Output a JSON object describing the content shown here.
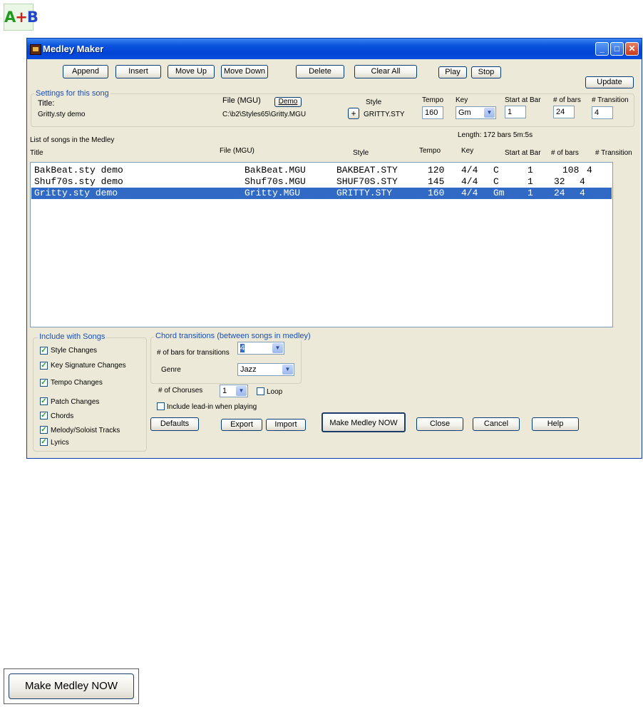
{
  "app_icon": {
    "a": "A",
    "plus": "+",
    "b": "B",
    "name": "a-plus-b-icon"
  },
  "window": {
    "title": "Medley Maker",
    "minimize": "_",
    "maximize": "□",
    "close": "✕"
  },
  "toolbar": {
    "append": "Append",
    "insert": "Insert",
    "move_up": "Move Up",
    "move_down": "Move Down",
    "delete": "Delete",
    "clear_all": "Clear All",
    "play": "Play",
    "stop": "Stop",
    "update": "Update"
  },
  "settings": {
    "group_title": "Settings for this song",
    "title_label": "Title:",
    "title_value": "Gritty.sty demo",
    "file_label": "File (MGU)",
    "demo_button": "Demo",
    "file_value": "C:\\b2\\Styles65\\Gritty.MGU",
    "plus_button": "+",
    "style_label": "Style",
    "style_value": "GRITTY.STY",
    "tempo_label": "Tempo",
    "tempo_value": "160",
    "key_label": "Key",
    "key_value": "Gm",
    "start_label": "Start at Bar",
    "start_value": "1",
    "bars_label": "# of bars",
    "bars_value": "24",
    "transition_label": "# Transition",
    "transition_value": "4"
  },
  "medley": {
    "list_label": "List of songs in the Medley",
    "length_text": "Length:  172 bars  5m:5s",
    "headers": {
      "title": "Title",
      "file": "File (MGU)",
      "style": "Style",
      "tempo": "Tempo",
      "key": "Key",
      "start": "Start at Bar",
      "bars": "# of bars",
      "transition": "# Transition"
    },
    "rows": [
      {
        "title": "BakBeat.sty demo",
        "file": "BakBeat.MGU",
        "style": "BAKBEAT.STY",
        "tempo": "120",
        "time": "4/4",
        "key": "C",
        "start": "1",
        "bars": "108",
        "transition": "4"
      },
      {
        "title": "Shuf70s.sty demo",
        "file": "Shuf70s.MGU",
        "style": "SHUF70S.STY",
        "tempo": "145",
        "time": "4/4",
        "key": "C",
        "start": "1",
        "bars": "32",
        "transition": "4"
      },
      {
        "title": "Gritty.sty demo",
        "file": "Gritty.MGU",
        "style": "GRITTY.STY",
        "tempo": "160",
        "time": "4/4",
        "key": "Gm",
        "start": "1",
        "bars": "24",
        "transition": "4"
      }
    ]
  },
  "include": {
    "group_title": "Include with Songs",
    "items": [
      {
        "label": "Style Changes",
        "checked": true
      },
      {
        "label": "Key Signature Changes",
        "checked": true
      },
      {
        "label": "Tempo Changes",
        "checked": true
      },
      {
        "label": "Patch Changes",
        "checked": true
      },
      {
        "label": "Chords",
        "checked": true
      },
      {
        "label": "Melody/Soloist Tracks",
        "checked": true
      },
      {
        "label": "Lyrics",
        "checked": true
      }
    ]
  },
  "chord_transitions": {
    "group_title": "Chord transitions (between songs in medley)",
    "bars_label": "# of bars for transitions",
    "bars_value": "4",
    "genre_label": "Genre",
    "genre_value": "Jazz"
  },
  "choruses": {
    "label": "# of Choruses",
    "value": "1",
    "loop_label": "Loop"
  },
  "lead_in": {
    "label": "Include lead-in when playing"
  },
  "bottom": {
    "defaults": "Defaults",
    "export": "Export",
    "import": "Import",
    "make_medley": "Make Medley NOW",
    "close": "Close",
    "cancel": "Cancel",
    "help": "Help"
  },
  "big_button": {
    "label": "Make Medley NOW"
  },
  "check_mark": "✓",
  "combo_arrow": "▼",
  "colors": {
    "title_bar": "#0a53dd",
    "selection": "#316ac5",
    "group_title": "#1a4fb5",
    "dialog_bg": "#ece9d8"
  }
}
